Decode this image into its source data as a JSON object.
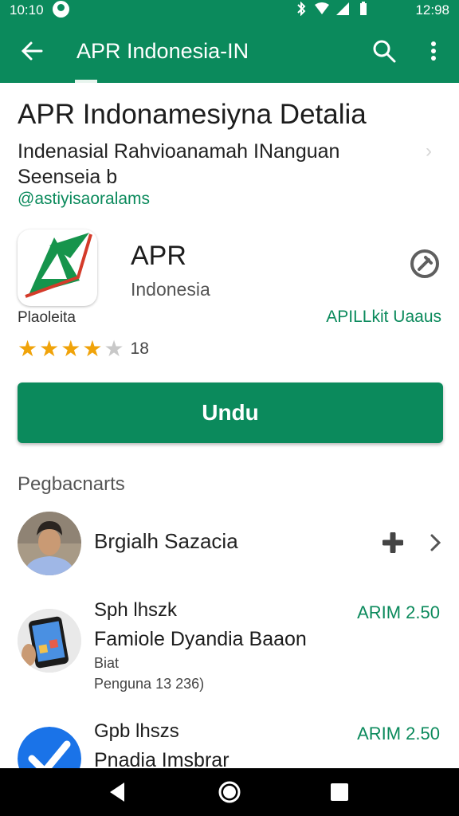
{
  "status": {
    "time_left": "10:10",
    "time_right": "12:98"
  },
  "appbar": {
    "title": "APR Indonesia-IN"
  },
  "header": {
    "title": "APR Indonamesiyna Detalia",
    "subtitle_line1": "Indenasial Rahvioanamah INanguan",
    "subtitle_line2": "Seenseia b",
    "handle": "@astiyisaoralams"
  },
  "app": {
    "name": "APR",
    "subtitle": "Indonesia",
    "developer": "Plaoleita",
    "link": "APILLkit Uaaus",
    "rating_count": "18",
    "stars": 4,
    "install_label": "Undu"
  },
  "section": {
    "title": "Pegbacnarts"
  },
  "user_row": {
    "name": "Brgialh Sazacia"
  },
  "items": [
    {
      "title": "Sph lhszk",
      "price": "ARIM 2.50",
      "line2": "Famiole Dyandia Baaon",
      "line3": "Biat",
      "line4": "Penguna 13 236)"
    },
    {
      "title": "Gpb lhszs",
      "price": "ARIM 2.50",
      "line2": "Pnadia Imsbrar"
    }
  ],
  "colors": {
    "brand": "#0b8a5c",
    "star": "#f0a30a"
  }
}
